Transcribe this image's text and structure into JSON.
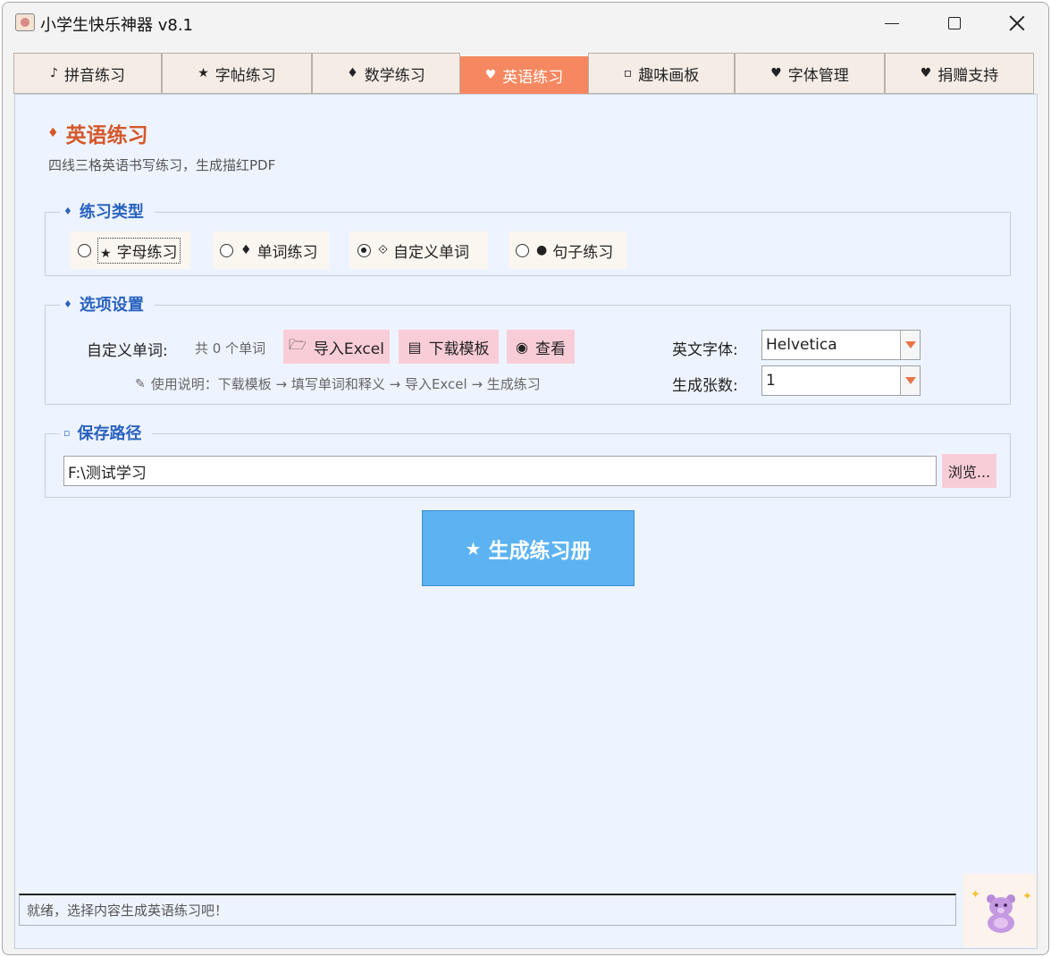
{
  "window": {
    "title": "小学生快乐神器 v8.1"
  },
  "tabs": [
    {
      "icon": "♪",
      "icon_name": "music-note-icon",
      "label": "拼音练习"
    },
    {
      "icon": "★",
      "icon_name": "star-icon",
      "label": "字帖练习"
    },
    {
      "icon": "♦",
      "icon_name": "diamond-icon",
      "label": "数学练习"
    },
    {
      "icon": "♥",
      "icon_name": "heart-icon",
      "label": "英语练习",
      "active": true
    },
    {
      "icon": "▫",
      "icon_name": "small-circle-icon",
      "label": "趣味画板"
    },
    {
      "icon": "♥",
      "icon_name": "heart-icon",
      "label": "字体管理"
    },
    {
      "icon": "♥",
      "icon_name": "heart-icon",
      "label": "捐赠支持"
    }
  ],
  "header": {
    "icon": "♦",
    "title": "英语练习",
    "subtitle": "四线三格英语书写练习，生成描红PDF"
  },
  "practice_type": {
    "label": "练习类型",
    "icon": "♦",
    "options": [
      {
        "icon": "★",
        "label": "字母练习",
        "selected": false
      },
      {
        "icon": "♦",
        "label": "单词练习",
        "selected": false
      },
      {
        "icon": "⟐",
        "label": "自定义单词",
        "selected": true
      },
      {
        "icon": "●",
        "label": "句子练习",
        "selected": false
      }
    ]
  },
  "options": {
    "label": "选项设置",
    "icon": "♦",
    "custom_words_label": "自定义单词:",
    "count_text": "共 0 个单词",
    "import_button": "导入Excel",
    "template_button": "下载模板",
    "view_button": "查看",
    "hint": "使用说明：下载模板 → 填写单词和释义 → 导入Excel → 生成练习",
    "font_label": "英文字体:",
    "font_value": "Helvetica",
    "pages_label": "生成张数:",
    "pages_value": "1"
  },
  "save_path": {
    "label": "保存路径",
    "icon": "▫",
    "value": "F:\\测试学习",
    "browse_button": "浏览..."
  },
  "generate_button": {
    "icon": "★",
    "label": "生成练习册"
  },
  "status": {
    "text": "就绪，选择内容生成英语练习吧！"
  },
  "colors": {
    "accent": "#f58860",
    "title": "#d4572a",
    "group_label": "#2a62c0",
    "pink_button": "#f9cdd8",
    "generate": "#5db3f2",
    "panel": "#eef4ff"
  }
}
